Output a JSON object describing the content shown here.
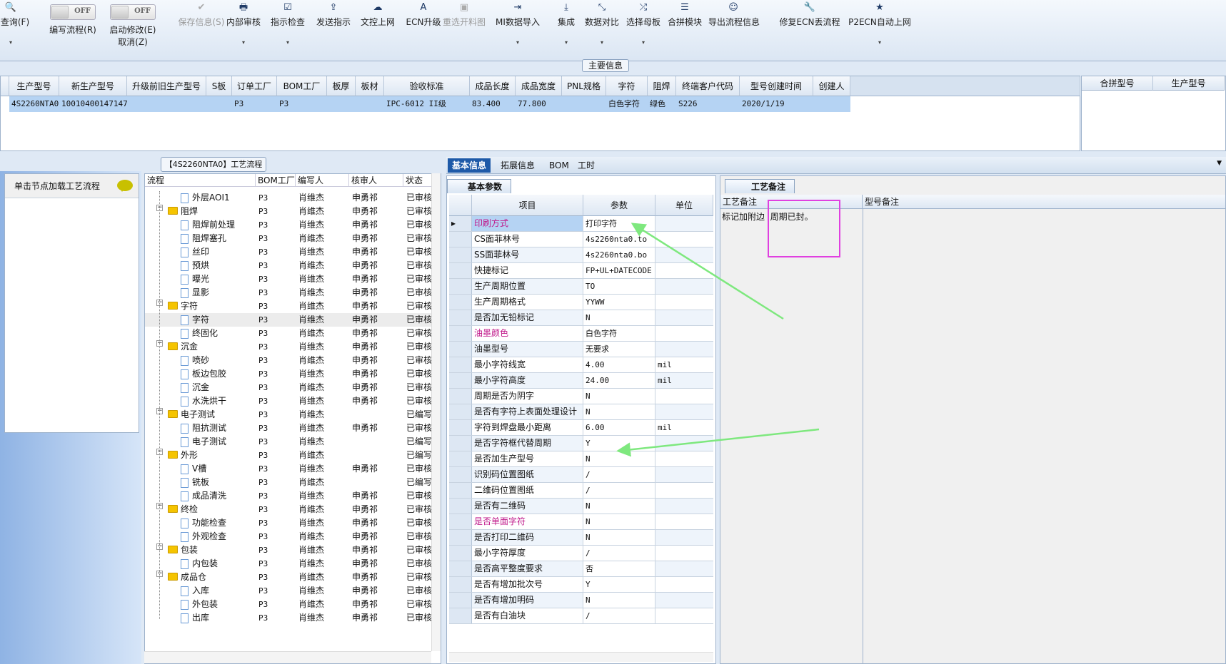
{
  "toolbar": {
    "items": [
      {
        "label": "号查询(F)",
        "icon": "search-icon",
        "glyph": "🔍",
        "dropdown": true
      },
      {
        "label": "编写流程(R)",
        "toggle": "OFF"
      },
      {
        "label": "启动修改(E)",
        "label2": "取消(Z)",
        "toggle": "OFF"
      },
      {
        "label": "保存信息(S)",
        "icon": "check-icon",
        "glyph": "✔",
        "disabled": true
      },
      {
        "label": "内部审核",
        "icon": "print-icon",
        "glyph": "🖶",
        "dropdown": true
      },
      {
        "label": "指示检查",
        "icon": "checkbox-icon",
        "glyph": "☑",
        "dropdown": true
      },
      {
        "label": "发送指示",
        "icon": "upload-icon",
        "glyph": "⇪"
      },
      {
        "label": "文控上网",
        "icon": "cloud-upload-icon",
        "glyph": "☁"
      },
      {
        "label": "ECN升级",
        "icon": "font-icon",
        "glyph": "A"
      },
      {
        "label": "重选开料图",
        "icon": "image-icon",
        "glyph": "▣",
        "disabled": true
      },
      {
        "label": "MI数据导入",
        "icon": "sign-in-icon",
        "glyph": "⇥",
        "dropdown": true
      },
      {
        "label": "集成",
        "icon": "download-icon",
        "glyph": "⤓",
        "dropdown": true
      },
      {
        "label": "数据对比",
        "icon": "compress-icon",
        "glyph": "⤡",
        "dropdown": true
      },
      {
        "label": "选择母板",
        "icon": "random-icon",
        "glyph": "⤮",
        "dropdown": true
      },
      {
        "label": "合拼模块",
        "icon": "list-icon",
        "glyph": "☰"
      },
      {
        "label": "导出流程信息",
        "icon": "smile-icon",
        "glyph": "☺"
      },
      {
        "label": "修复ECN丢流程",
        "icon": "wrench-icon",
        "glyph": "🔧"
      },
      {
        "label": "P2ECN自动上网",
        "icon": "star-icon",
        "glyph": "★",
        "dropdown": true
      }
    ]
  },
  "main_info": {
    "group_title": "主要信息",
    "columns": [
      "生产型号",
      "新生产型号",
      "升级前旧生产型号",
      "S板",
      "订单工厂",
      "BOM工厂",
      "板厚",
      "板材",
      "验收标准",
      "成品长度",
      "成品宽度",
      "PNL规格",
      "字符",
      "阻焊",
      "终端客户代码",
      "型号创建时间",
      "创建人"
    ],
    "row": [
      "4S2260NTA0",
      "10010400147147",
      "",
      "",
      "P3",
      "P3",
      "",
      "",
      "IPC-6012 II级",
      "83.400",
      "77.800",
      "",
      "白色字符",
      "绿色",
      "S226",
      "2020/1/19",
      ""
    ]
  },
  "merge_panel": {
    "columns": [
      "合拼型号",
      "生产型号"
    ]
  },
  "left_panel": {
    "hint": "单击节点加载工艺流程"
  },
  "flow": {
    "title": "【4S2260NTA0】工艺流程",
    "columns": [
      "流程",
      "BOM工厂",
      "编写人",
      "核审人",
      "状态"
    ],
    "rows": [
      [
        "file",
        "外层AOI1",
        "P3",
        "肖维杰",
        "申勇祁",
        "已审核"
      ],
      [
        "folder",
        "阻焊",
        "P3",
        "肖维杰",
        "申勇祁",
        "已审核"
      ],
      [
        "file",
        "阻焊前处理",
        "P3",
        "肖维杰",
        "申勇祁",
        "已审核"
      ],
      [
        "file",
        "阻焊塞孔",
        "P3",
        "肖维杰",
        "申勇祁",
        "已审核"
      ],
      [
        "file",
        "丝印",
        "P3",
        "肖维杰",
        "申勇祁",
        "已审核"
      ],
      [
        "file",
        "预烘",
        "P3",
        "肖维杰",
        "申勇祁",
        "已审核"
      ],
      [
        "file",
        "曝光",
        "P3",
        "肖维杰",
        "申勇祁",
        "已审核"
      ],
      [
        "file",
        "显影",
        "P3",
        "肖维杰",
        "申勇祁",
        "已审核"
      ],
      [
        "folder",
        "字符",
        "P3",
        "肖维杰",
        "申勇祁",
        "已审核"
      ],
      [
        "file",
        "字符",
        "P3",
        "肖维杰",
        "申勇祁",
        "已审核"
      ],
      [
        "file",
        "终固化",
        "P3",
        "肖维杰",
        "申勇祁",
        "已审核"
      ],
      [
        "folder",
        "沉金",
        "P3",
        "肖维杰",
        "申勇祁",
        "已审核"
      ],
      [
        "file",
        "喷砂",
        "P3",
        "肖维杰",
        "申勇祁",
        "已审核"
      ],
      [
        "file",
        "板边包胶",
        "P3",
        "肖维杰",
        "申勇祁",
        "已审核"
      ],
      [
        "file",
        "沉金",
        "P3",
        "肖维杰",
        "申勇祁",
        "已审核"
      ],
      [
        "file",
        "水洗烘干",
        "P3",
        "肖维杰",
        "申勇祁",
        "已审核"
      ],
      [
        "folder",
        "电子测试",
        "P3",
        "肖维杰",
        "",
        "已编写"
      ],
      [
        "file",
        "阻抗测试",
        "P3",
        "肖维杰",
        "申勇祁",
        "已审核"
      ],
      [
        "file",
        "电子测试",
        "P3",
        "肖维杰",
        "",
        "已编写"
      ],
      [
        "folder",
        "外形",
        "P3",
        "肖维杰",
        "",
        "已编写"
      ],
      [
        "file",
        "V槽",
        "P3",
        "肖维杰",
        "申勇祁",
        "已审核"
      ],
      [
        "file",
        "铣板",
        "P3",
        "肖维杰",
        "",
        "已编写"
      ],
      [
        "file",
        "成品清洗",
        "P3",
        "肖维杰",
        "申勇祁",
        "已审核"
      ],
      [
        "folder",
        "终检",
        "P3",
        "肖维杰",
        "申勇祁",
        "已审核"
      ],
      [
        "file",
        "功能检查",
        "P3",
        "肖维杰",
        "申勇祁",
        "已审核"
      ],
      [
        "file",
        "外观检查",
        "P3",
        "肖维杰",
        "申勇祁",
        "已审核"
      ],
      [
        "folder",
        "包装",
        "P3",
        "肖维杰",
        "申勇祁",
        "已审核"
      ],
      [
        "file",
        "内包装",
        "P3",
        "肖维杰",
        "申勇祁",
        "已审核"
      ],
      [
        "folder",
        "成品仓",
        "P3",
        "肖维杰",
        "申勇祁",
        "已审核"
      ],
      [
        "file",
        "入库",
        "P3",
        "肖维杰",
        "申勇祁",
        "已审核"
      ],
      [
        "file",
        "外包装",
        "P3",
        "肖维杰",
        "申勇祁",
        "已审核"
      ],
      [
        "file",
        "出库",
        "P3",
        "肖维杰",
        "申勇祁",
        "已审核"
      ]
    ],
    "selected_index": 9
  },
  "detail_tabs": [
    "基本信息",
    "拓展信息",
    "BOM",
    "工时"
  ],
  "params": {
    "subtab": "基本参数",
    "columns": [
      "项目",
      "参数",
      "单位"
    ],
    "rows": [
      [
        "印刷方式",
        "打印字符",
        "",
        true
      ],
      [
        "CS面菲林号",
        "4s2260nta0.to",
        "",
        false
      ],
      [
        "SS面菲林号",
        "4s2260nta0.bo",
        "",
        false
      ],
      [
        "快捷标记",
        "FP+UL+DATECODE",
        "",
        false
      ],
      [
        "生产周期位置",
        "TO",
        "",
        false
      ],
      [
        "生产周期格式",
        "YYWW",
        "",
        false
      ],
      [
        "是否加无铅标记",
        "N",
        "",
        false
      ],
      [
        "油墨颜色",
        "白色字符",
        "",
        true
      ],
      [
        "油墨型号",
        "无要求",
        "",
        false
      ],
      [
        "最小字符线宽",
        "4.00",
        "mil",
        false
      ],
      [
        "最小字符高度",
        "24.00",
        "mil",
        false
      ],
      [
        "周期是否为阴字",
        "N",
        "",
        false
      ],
      [
        "是否有字符上表面处理设计",
        "N",
        "",
        false
      ],
      [
        "字符到焊盘最小距离",
        "6.00",
        "mil",
        false
      ],
      [
        "是否字符框代替周期",
        "Y",
        "",
        false
      ],
      [
        "是否加生产型号",
        "N",
        "",
        false
      ],
      [
        "识别码位置图纸",
        "/",
        "",
        false
      ],
      [
        "二维码位置图纸",
        "/",
        "",
        false
      ],
      [
        "是否有二维码",
        "N",
        "",
        false
      ],
      [
        "是否单面字符",
        "N",
        "",
        true
      ],
      [
        "是否打印二维码",
        "N",
        "",
        false
      ],
      [
        "最小字符厚度",
        "/",
        "",
        false
      ],
      [
        "是否高平整度要求",
        "否",
        "",
        false
      ],
      [
        "是否有增加批次号",
        "Y",
        "",
        false
      ],
      [
        "是否有增加明码",
        "N",
        "",
        false
      ],
      [
        "是否有白油块",
        "/",
        "",
        false
      ]
    ]
  },
  "notes": {
    "tab": "工艺备注",
    "columns": [
      "工艺备注",
      "型号备注"
    ],
    "process_note": "标记加附边  周期已封。"
  },
  "annotation_colors": {
    "arrow": "#7ee87e",
    "box": "#e040e0",
    "accent": "#1e5aa8"
  }
}
